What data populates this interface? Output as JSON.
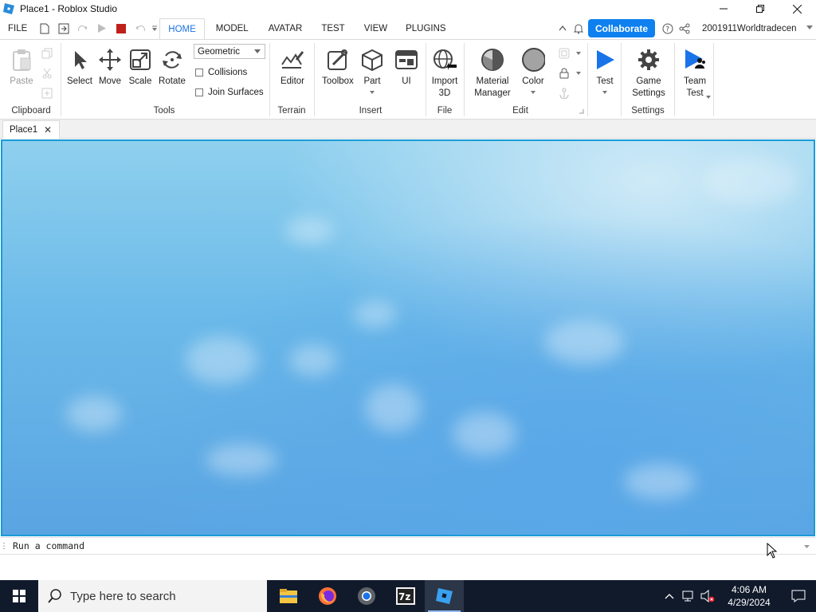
{
  "window": {
    "title": "Place1 - Roblox Studio"
  },
  "menu": {
    "tabs": [
      {
        "label": "FILE"
      },
      {
        "label": "HOME"
      },
      {
        "label": "MODEL"
      },
      {
        "label": "AVATAR"
      },
      {
        "label": "TEST"
      },
      {
        "label": "VIEW"
      },
      {
        "label": "PLUGINS"
      }
    ],
    "active_tab": "HOME",
    "collaborate_label": "Collaborate",
    "username": "2001911Worldtradecen"
  },
  "ribbon": {
    "groups": {
      "clipboard": "Clipboard",
      "tools": "Tools",
      "terrain": "Terrain",
      "insert": "Insert",
      "file": "File",
      "edit": "Edit",
      "settings": "Settings"
    },
    "buttons": {
      "paste": "Paste",
      "select": "Select",
      "move": "Move",
      "scale": "Scale",
      "rotate": "Rotate",
      "editor": "Editor",
      "toolbox": "Toolbox",
      "part": "Part",
      "ui": "UI",
      "import3d_line1": "Import",
      "import3d_line2": "3D",
      "material_line1": "Material",
      "material_line2": "Manager",
      "color": "Color",
      "test": "Test",
      "game_settings_line1": "Game",
      "game_settings_line2": "Settings",
      "team_test_line1": "Team",
      "team_test_line2": "Test"
    },
    "transform_mode": "Geometric",
    "collisions_label": "Collisions",
    "collisions_checked": false,
    "join_surfaces_label": "Join Surfaces",
    "join_surfaces_checked": false
  },
  "document_tabs": [
    {
      "label": "Place1"
    }
  ],
  "command_bar": {
    "placeholder": "Run a command"
  },
  "taskbar": {
    "search_placeholder": "Type here to search",
    "apps": [
      "file-explorer",
      "firefox",
      "chrome",
      "7zip",
      "roblox-studio"
    ],
    "clock_time": "4:06 AM",
    "clock_date": "4/29/2024"
  },
  "colors": {
    "accent": "#1a73e8",
    "collaborate_bg": "#0e80ef",
    "viewport_border": "#1a9bd7",
    "stop_red": "#c0201a",
    "taskbar_bg": "#101a2b"
  }
}
